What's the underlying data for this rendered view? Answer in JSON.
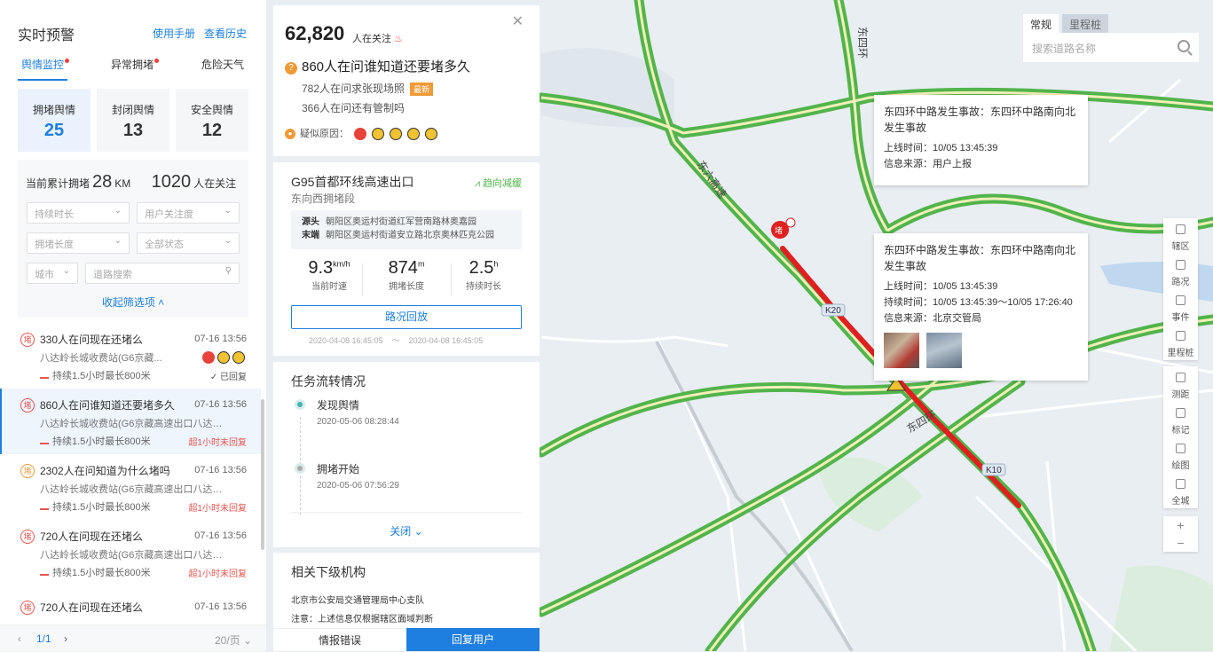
{
  "colors": {
    "accent": "#1f7fe0",
    "alert": "#e85650",
    "road_green": "#52b44c",
    "congestion": "#e02020"
  },
  "left": {
    "title": "实时预警",
    "links": [
      "使用手册",
      "查看历史"
    ],
    "tabs": [
      "舆情监控",
      "异常拥堵",
      "危险天气"
    ],
    "cards": [
      {
        "label": "拥堵舆情",
        "value": "25"
      },
      {
        "label": "封闭舆情",
        "value": "13"
      },
      {
        "label": "安全舆情",
        "value": "12"
      }
    ],
    "summary": {
      "prefix": "当前累计拥堵",
      "km": "28",
      "km_unit": "KM",
      "watchers": "1020",
      "watchers_suffix": "人在关注"
    },
    "filters": {
      "duration": "持续时长",
      "attention": "用户关注度",
      "length": "拥堵长度",
      "status": "全部状态",
      "city": "城市",
      "road_placeholder": "道路搜索",
      "collapse": "收起筛选项"
    },
    "items": [
      {
        "badge": "堵",
        "title": "330人在问现在还堵么",
        "time": "07-16 13:56",
        "sub": "八达岭长城收费站(G6京藏...",
        "dur": "持续1.5小时最长800米",
        "status": "已回复"
      },
      {
        "badge": "堵",
        "title": "860人在问谁知道还要堵多久",
        "time": "07-16 13:56",
        "sub": "八达岭长城收费站(G6京藏高速出口八达岭...",
        "dur": "持续1.5小时最长800米",
        "status": "超1小时未回复"
      },
      {
        "badge": "堵",
        "title": "2302人在问知道为什么堵吗",
        "time": "07-16 13:56",
        "sub": "八达岭长城收费站(G6京藏高速出口八达岭...",
        "dur": "持续1.5小时最长800米",
        "status": "超1小时未回复"
      },
      {
        "badge": "堵",
        "title": "720人在问现在还堵么",
        "time": "07-16 13:56",
        "sub": "八达岭长城收费站(G6京藏高速出口八达岭...",
        "dur": "持续1.5小时最长800米",
        "status": "超1小时未回复"
      },
      {
        "badge": "堵",
        "title": "720人在问现在还堵么",
        "time": "07-16 13:56",
        "sub": "",
        "dur": "",
        "status": ""
      }
    ],
    "pager": {
      "page": "1/1",
      "size": "20/页"
    }
  },
  "detail": {
    "watchers": "62,820",
    "watchers_suffix": "人在关注",
    "question": "860人在问谁知道还要堵多久",
    "line1": "782人在问求张现场照",
    "new_tag": "最新",
    "line2": "366人在问还有管制吗",
    "reason": "疑似原因：",
    "road": "G95首都环线高速出口",
    "direction": "东向西拥堵段",
    "trend": "趋向减缓",
    "source_label": "源头",
    "source": "朝阳区奥运村街道红军营南路林奥嘉园",
    "end_label": "末端",
    "end": "朝阳区奥运村街道安立路北京奥林匹克公园",
    "speed": "9.3",
    "speed_unit": "km/h",
    "speed_label": "当前时速",
    "length": "874",
    "length_unit": "m",
    "length_label": "拥堵长度",
    "duration": "2.5",
    "duration_unit": "h",
    "duration_label": "持续时长",
    "replay": "路况回放",
    "date_from": "2020-04-08 16:45:05",
    "date_sep": "～",
    "date_to": "2020-04-08 16:45:05",
    "task_title": "任务流转情况",
    "task_steps": [
      {
        "name": "发现舆情",
        "time": "2020-05-06 08:28:44"
      },
      {
        "name": "拥堵开始",
        "time": "2020-05-06 07:56:29"
      }
    ],
    "close": "关闭",
    "org_title": "相关下级机构",
    "org": "北京市公安局交通管理局中心支队",
    "note": "注意：上述信息仅根据辖区面域判断",
    "btn_error": "情报错误",
    "btn_reply": "回复用户"
  },
  "map": {
    "search_tabs": [
      "常规",
      "里程桩"
    ],
    "search_placeholder": "搜索道路名称",
    "popup1": {
      "title": "东四环中路发生事故：东四环中路南向北发生事故",
      "online_label": "上线时间：",
      "online": "10/05 13:45:39",
      "source_label": "信息来源：",
      "source": "用户上报"
    },
    "popup2": {
      "title": "东四环中路发生事故：东四环中路南向北发生事故",
      "online_label": "上线时间：",
      "online": "10/05 13:45:39",
      "dur_label": "持续时间：",
      "dur": "10/05 13:45:39～10/05 17:26:40",
      "source_label": "信息来源：",
      "source": "北京交管局"
    },
    "tools": [
      "辖区",
      "路况",
      "事件",
      "里程桩",
      "测距",
      "标记",
      "绘图",
      "全城"
    ],
    "zoom_in": "+",
    "zoom_out": "−",
    "marker": "堵",
    "labels": {
      "east4": "东四环",
      "k20": "K20",
      "k10": "K10",
      "east4_diag": "东四环",
      "east_pass": "东六高速",
      "east4b": "东四环"
    }
  }
}
